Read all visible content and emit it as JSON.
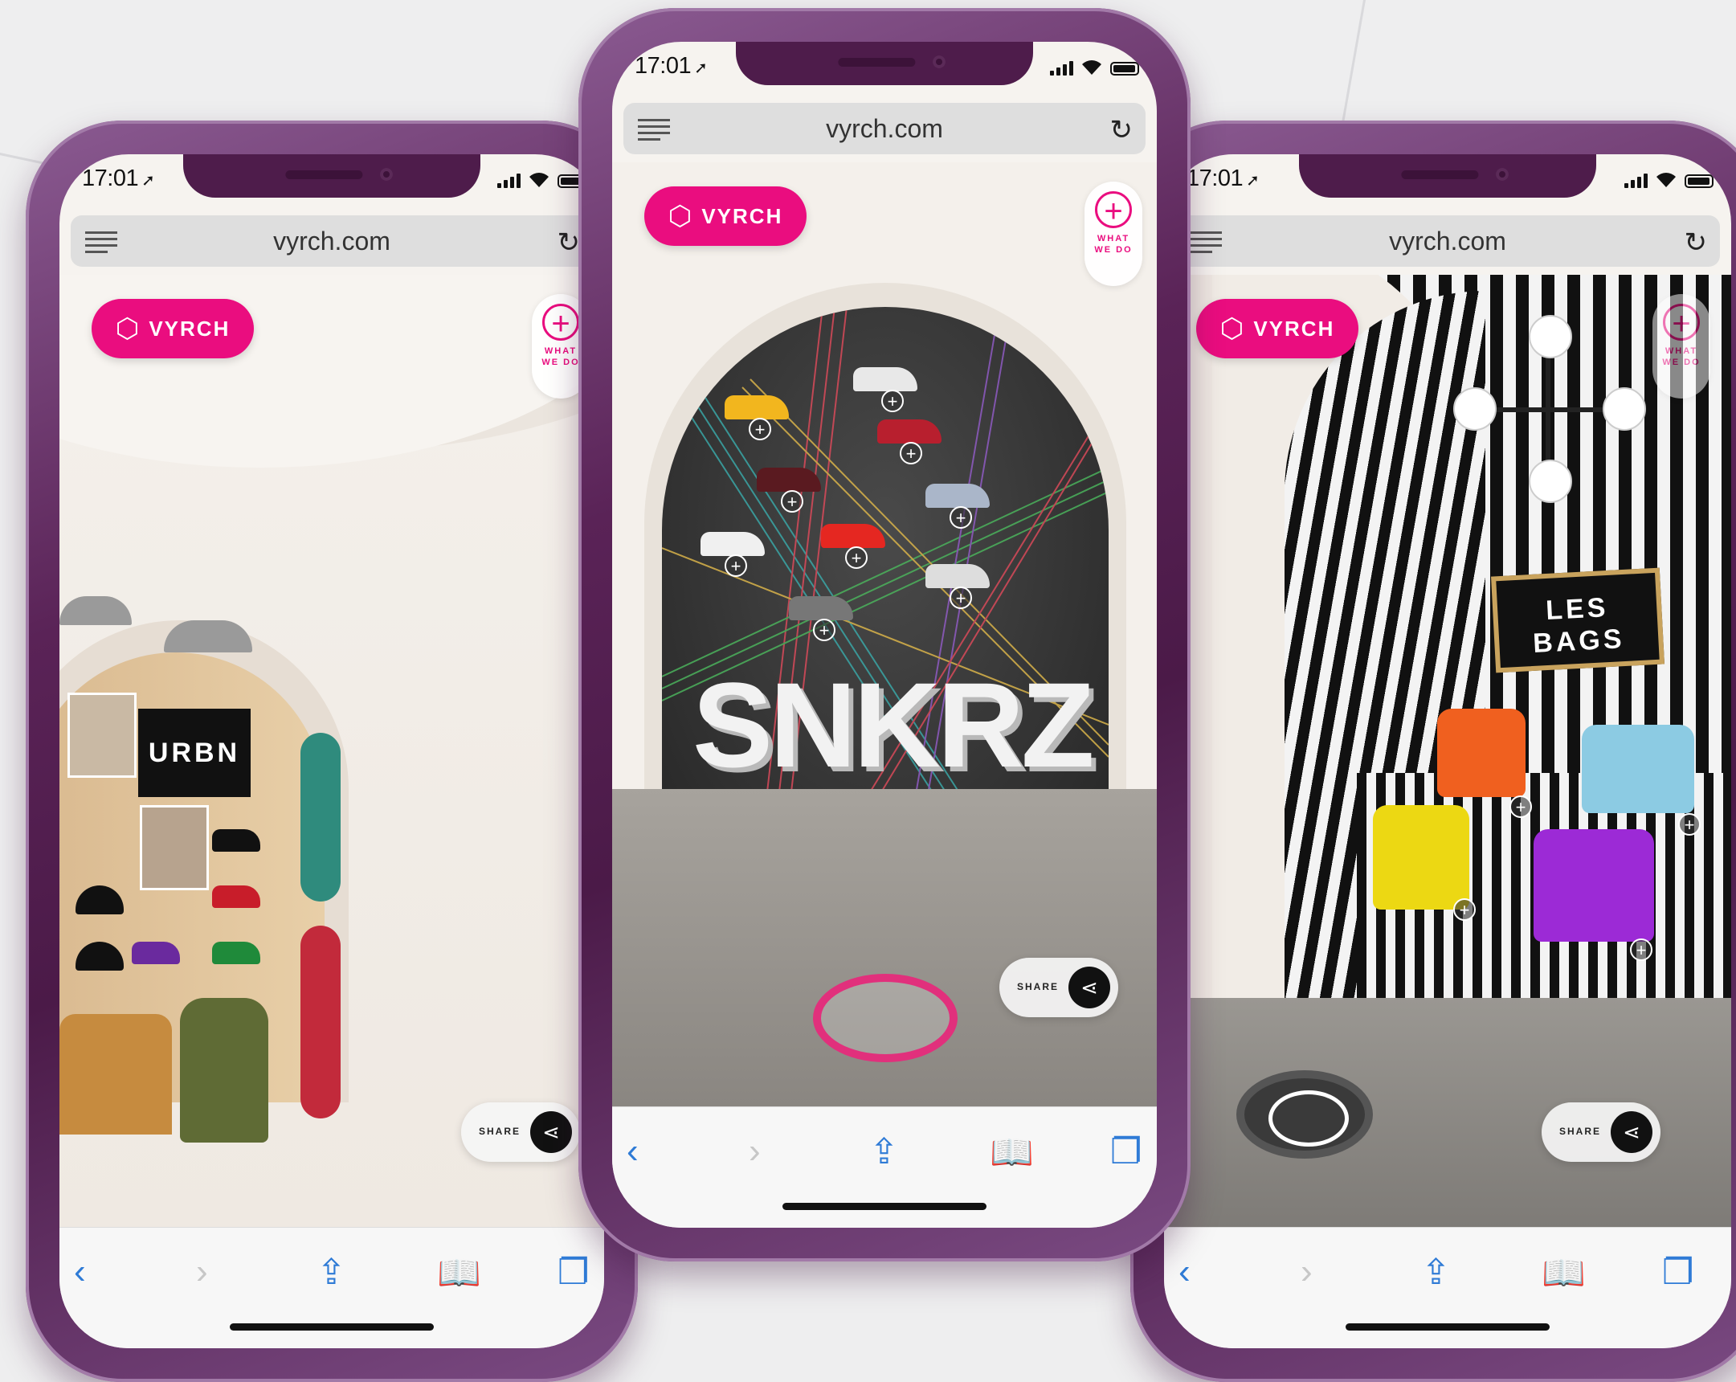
{
  "phones": [
    {
      "status": {
        "time": "17:01"
      },
      "browser": {
        "url": "vyrch.com"
      },
      "brand": {
        "name": "VYRCH"
      },
      "what_we_do": {
        "line1": "WHAT",
        "line2": "WE DO"
      },
      "scene_sign": "URBN",
      "share": {
        "label": "SHARE"
      }
    },
    {
      "status": {
        "time": "17:01"
      },
      "browser": {
        "url": "vyrch.com"
      },
      "brand": {
        "name": "VYRCH"
      },
      "what_we_do": {
        "line1": "WHAT",
        "line2": "WE DO"
      },
      "scene_sign": "SNKRZ",
      "share": {
        "label": "SHARE"
      }
    },
    {
      "status": {
        "time": "17:01"
      },
      "browser": {
        "url": "vyrch.com"
      },
      "brand": {
        "name": "VYRCH"
      },
      "what_we_do": {
        "line1": "WHAT",
        "line2": "WE DO"
      },
      "scene_sign": "LES BAGS",
      "share": {
        "label": "SHARE"
      }
    }
  ],
  "icons": {
    "menu": "hamburger-icon",
    "reload": "reload-icon",
    "back": "chevron-left-icon",
    "forward": "chevron-right-icon",
    "share": "share-icon",
    "bookmarks": "book-icon",
    "tabs": "tabs-icon",
    "brand": "cube-icon",
    "plus": "plus-icon"
  },
  "colors": {
    "brand_pink": "#ea0d7f",
    "phone_frame": "#5a2357",
    "toolbar_blue": "#2f7bd6"
  }
}
